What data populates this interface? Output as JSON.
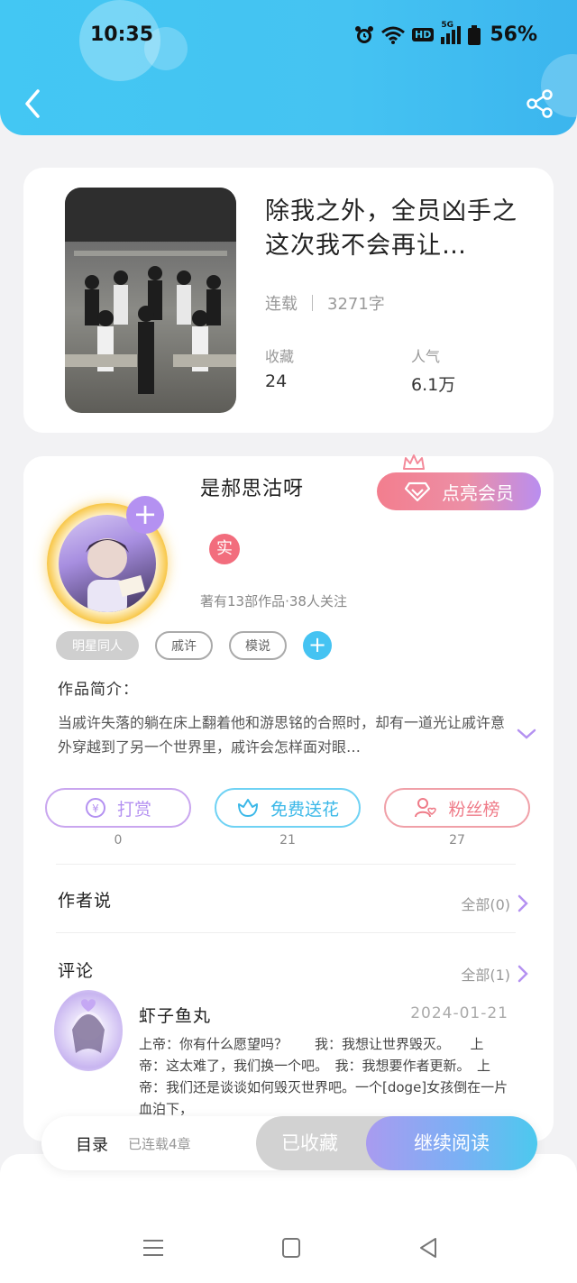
{
  "status": {
    "time": "10:35",
    "network_badge": "HD",
    "signal_label": "5G",
    "battery": "56%"
  },
  "header": {
    "back_icon": "chevron-left-icon",
    "share_icon": "share-icon"
  },
  "book": {
    "title": "除我之外，全员凶手之这次我不会再让…",
    "status": "连载",
    "word_count": "3271字",
    "favorites_label": "收藏",
    "favorites_value": "24",
    "popularity_label": "人气",
    "popularity_value": "6.1万"
  },
  "author": {
    "name": "是郝思沽呀",
    "verified_badge": "实",
    "stats": "著有13部作品·38人关注",
    "vip_button": "点亮会员",
    "tags": [
      "明星同人",
      "戚许",
      "模说"
    ]
  },
  "intro": {
    "label": "作品简介：",
    "text": "当戚许失落的躺在床上翻着他和游思铭的合照时，却有一道光让戚许意外穿越到了另一个世界里，戚许会怎样面对眼…"
  },
  "actions": {
    "tip_label": "打赏",
    "tip_count": "0",
    "flower_label": "免费送花",
    "flower_count": "21",
    "fans_label": "粉丝榜",
    "fans_count": "27"
  },
  "author_says": {
    "title": "作者说",
    "link": "全部(0)"
  },
  "comments": {
    "title": "评论",
    "link": "全部(1)",
    "items": [
      {
        "user": "虾子鱼丸",
        "date": "2024-01-21",
        "text": "上帝：你有什么愿望吗？　　我：我想让世界毁灭。　　上帝：这太难了，我们换一个吧。　我：我想要作者更新。　上帝：我们还是谈谈如何毁灭世界吧。一个[doge]女孩倒在一片血泊下，"
      }
    ]
  },
  "bottom_bar": {
    "toc_label": "目录",
    "toc_status": "已连载4章",
    "fav_button": "已收藏",
    "read_button": "继续阅读"
  },
  "colors": {
    "header": "#43c7f3",
    "accent_purple": "#b491f1",
    "accent_blue": "#45c3f2",
    "accent_pink": "#ef7b88"
  }
}
